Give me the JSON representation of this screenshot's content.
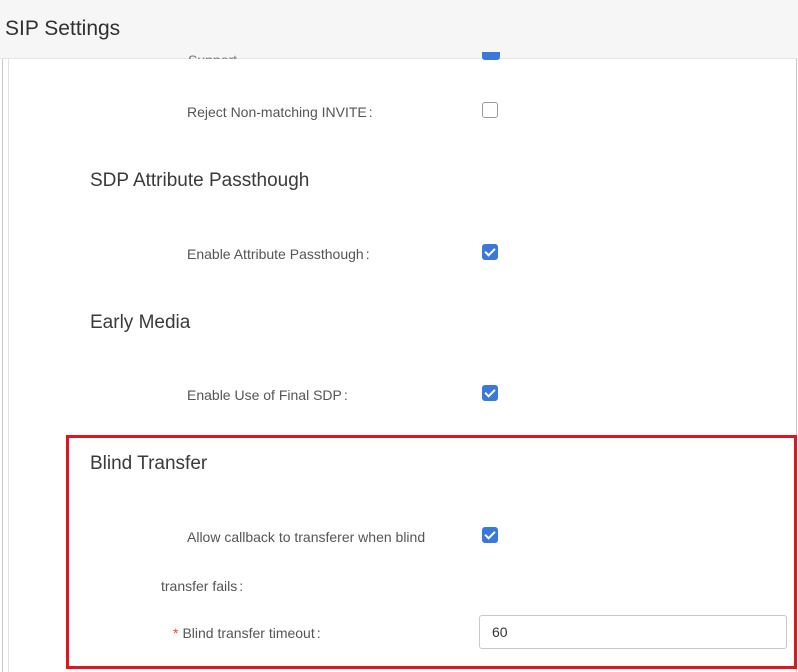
{
  "header": {
    "title": "SIP Settings"
  },
  "partial_row": {
    "label": "Support",
    "checked": true
  },
  "reject_row": {
    "label": "Reject Non-matching INVITE",
    "colon": ":",
    "checked": false
  },
  "sdp_section": {
    "title": "SDP Attribute Passthough",
    "enable_label": "Enable Attribute Passthough",
    "colon": ":",
    "checked": true
  },
  "early_media": {
    "title": "Early Media",
    "final_sdp_label": "Enable Use of Final SDP",
    "colon": ":",
    "checked": true
  },
  "blind_transfer": {
    "title": "Blind Transfer",
    "callback_label_line1": "Allow callback to transferer when blind",
    "callback_label_line2": "transfer fails",
    "colon": ":",
    "callback_checked": true,
    "required_mark": "*",
    "timeout_label": "Blind transfer timeout",
    "timeout_value": "60"
  },
  "colors": {
    "accent": "#3a78d9",
    "highlight": "#e0161e"
  }
}
